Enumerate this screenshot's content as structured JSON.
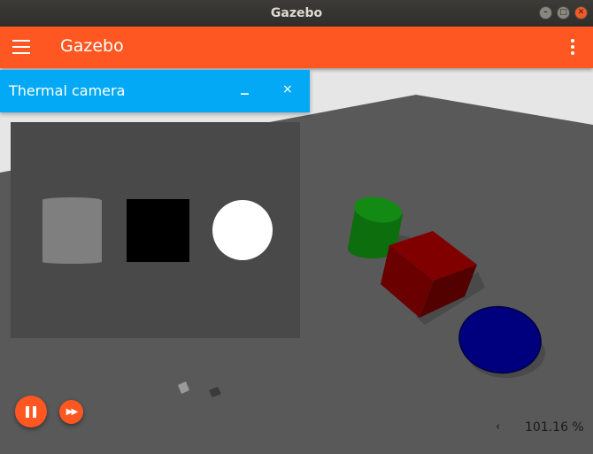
{
  "window": {
    "title": "Gazebo"
  },
  "appbar": {
    "title": "Gazebo"
  },
  "panel": {
    "title": "Thermal camera",
    "minimize_label": "_",
    "close_label": "×"
  },
  "controls": {
    "real_time_factor": "101.16 %",
    "rtf_toggle": "‹"
  },
  "icons": {
    "menu": "hamburger-icon",
    "more": "kebab-icon",
    "play": "pause-icon",
    "step": "fast-forward-icon"
  },
  "colors": {
    "titlebar": "#3c3b37",
    "appbar": "#ff5722",
    "panel_header": "#03a9f4",
    "ground": "#595959",
    "cylinder": "#0d6e0d",
    "box": "#7a0000",
    "sphere": "#00007f"
  }
}
